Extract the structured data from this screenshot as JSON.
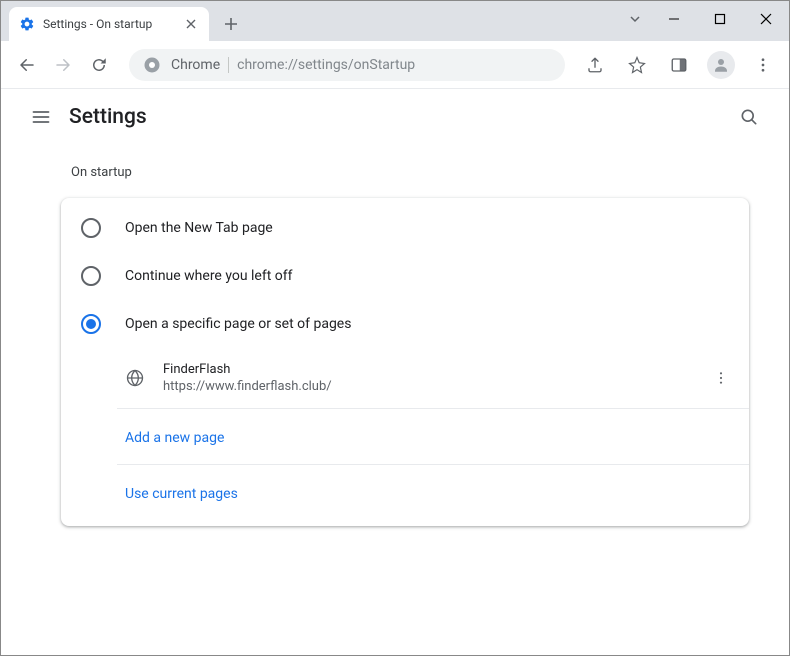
{
  "tab": {
    "title": "Settings - On startup"
  },
  "omnibox": {
    "host": "Chrome",
    "path": "chrome://settings/onStartup"
  },
  "header": {
    "title": "Settings"
  },
  "section": {
    "label": "On startup"
  },
  "options": {
    "newtab": "Open the New Tab page",
    "continue": "Continue where you left off",
    "specific": "Open a specific page or set of pages"
  },
  "page": {
    "name": "FinderFlash",
    "url": "https://www.finderflash.club/"
  },
  "links": {
    "add": "Add a new page",
    "current": "Use current pages"
  }
}
